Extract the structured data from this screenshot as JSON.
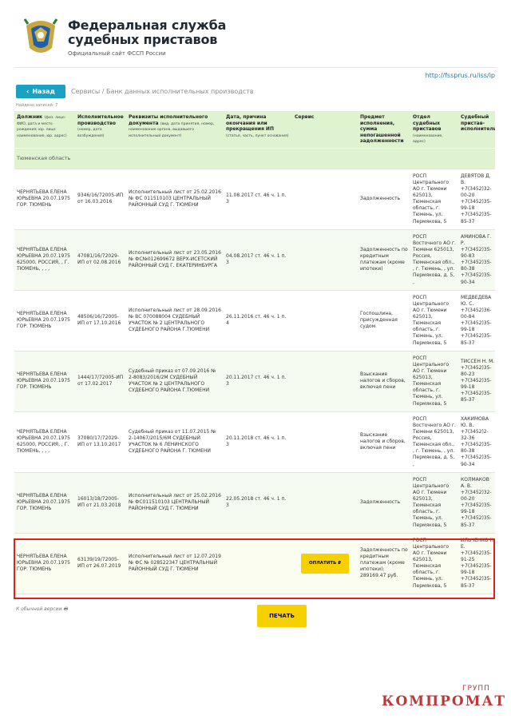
{
  "header": {
    "title_line1": "Федеральная служба",
    "title_line2": "судебных приставов",
    "subtitle": "Официальный сайт ФССП России"
  },
  "url": "http://fssprus.ru/iss/ip",
  "nav": {
    "back_label": "Назад",
    "breadcrumb": "Сервисы / Банк данных исполнительных производств"
  },
  "found": "Найдено записей: 7",
  "table": {
    "headers": [
      {
        "title": "Должник",
        "note": "(физ. лицо: ФИО, дата и место рождения; юр. лицо: наименование, юр. адрес)"
      },
      {
        "title": "Исполнительное производство",
        "note": "(номер, дата возбуждения)"
      },
      {
        "title": "Реквизиты исполнительного документа",
        "note": "(вид, дата принятия, номер, наименование органа, выдавшего исполнительный документ)"
      },
      {
        "title": "Дата, причина окончания или прекращения ИП",
        "note": "(статья, часть, пункт основания)"
      },
      {
        "title": "Сервис",
        "note": ""
      },
      {
        "title": "Предмет исполнения, сумма непогашенной задолженности",
        "note": ""
      },
      {
        "title": "Отдел судебных приставов",
        "note": "(наименование, адрес)"
      },
      {
        "title": "Судебный пристав-исполнитель",
        "note": ""
      }
    ],
    "region": "Тюменская область",
    "rows": [
      {
        "debtor": "ЧЕРНЯТЬЕВА ЕЛЕНА ЮРЬЕВНА 20.07.1975 ГОР. ТЮМЕНЬ",
        "ip": "9346/16/72005-ИП от 16.03.2016",
        "doc": "Исполнительный лист от 25.02.2016 № ФС 011510103 ЦЕНТРАЛЬНЫЙ РАЙОННЫЙ СУД Г. ТЮМЕНИ",
        "end": "11.08.2017 ст. 46 ч. 1 п. 3",
        "service": "",
        "subject": "Задолженность",
        "dept": "РОСП Центрального АО г. Тюмени 625013, Тюменская область, г. Тюмень, ул. Пермякова, 5",
        "bailiff": "ДЕВЯТОВ Д. В. +7(3452)32-00-20 +7(3452)35-99-18 +7(3452)35-85-37"
      },
      {
        "debtor": "ЧЕРНЯТЬЕВА ЕЛЕНА ЮРЬЕВНА 20.07.1975 625000, РОССИЯ, , Г. ТЮМЕНЬ, , , ,",
        "ip": "47081/16/72029-ИП от 02.08.2016",
        "doc": "Исполнительный лист от 23.05.2016 № ФС№012699672 ВЕРХ-ИСЕТСКИЙ РАЙОННЫЙ СУД Г. ЕКАТЕРИНБУРГА",
        "end": "04.08.2017 ст. 46 ч. 1 п. 3",
        "service": "",
        "subject": "Задолженность по кредитным платежам (кроме ипотеки)",
        "dept": "РОСП Восточного АО г. Тюмени 625013, Россия, Тюменская обл., , г. Тюмень, , ул. Пермякова, д. 5, ,",
        "bailiff": "АМИНОВА Г. Р. +7(3452)35-90-83 +7(3452)35-80-38 +7(3452)35-90-34"
      },
      {
        "debtor": "ЧЕРНЯТЬЕВА ЕЛЕНА ЮРЬЕВНА 20.07.1975 ГОР. ТЮМЕНЬ",
        "ip": "48506/16/72005-ИП от 17.10.2016",
        "doc": "Исполнительный лист от 28.09.2016 № ВС 070088004 СУДЕБНЫЙ УЧАСТОК № 2 ЦЕНТРАЛЬНОГО СУДЕБНОГО РАЙОНА Г.ТЮМЕНИ",
        "end": "26.11.2016 ст. 46 ч. 1 п. 4",
        "service": "",
        "subject": "Госпошлина, присужденная судом",
        "dept": "РОСП Центрального АО г. Тюмени 625013, Тюменская область, г. Тюмень, ул. Пермякова, 5",
        "bailiff": "МЕДВЕДЕВА Ю. С. +7(3452)36-00-84 +7(3452)35-99-18 +7(3452)35-85-37"
      },
      {
        "debtor": "ЧЕРНЯТЬЕВА ЕЛЕНА ЮРЬЕВНА 20.07.1975 ГОР. ТЮМЕНЬ",
        "ip": "1444/17/72005-ИП от 17.02.2017",
        "doc": "Судебный приказ от 07.09.2016 № 2-8083/2016/2М СУДЕБНЫЙ УЧАСТОК № 2 ЦЕНТРАЛЬНОГО СУДЕБНОГО РАЙОНА Г.ТЮМЕНИ",
        "end": "20.11.2017 ст. 46 ч. 1 п. 3",
        "service": "",
        "subject": "Взыскание налогов и сборов, включая пени",
        "dept": "РОСП Центрального АО г. Тюмени 625013, Тюменская область, г. Тюмень, ул. Пермякова, 5",
        "bailiff": "ТИССЕН Н. М. +7(3452)35-80-23 +7(3452)35-99-18 +7(3452)35-85-37"
      },
      {
        "debtor": "ЧЕРНЯТЬЕВА ЕЛЕНА ЮРЬЕВНА 20.07.1975 625000, РОССИЯ, , Г. ТЮМЕНЬ, , , ,",
        "ip": "37080/17/72029-ИП от 13.10.2017",
        "doc": "Судебный приказ от 11.07.2015 № 2-14067/2015/6М СУДЕБНЫЙ УЧАСТОК № 6 ЛЕНИНСКОГО СУДЕБНОГО РАЙОНА Г. ТЮМЕНИ",
        "end": "20.11.2018 ст. 46 ч. 1 п. 3",
        "service": "",
        "subject": "Взыскание налогов и сборов, включая пени",
        "dept": "РОСП Восточного АО г. Тюмени 625013, Россия, Тюменская обл., , г. Тюмень, , ул. Пермякова, д. 5, ,",
        "bailiff": "ХАКИМОВА Ю. В. +7(3452)2-32-36 +7(3452)35-80-38 +7(3452)35-90-34"
      },
      {
        "debtor": "ЧЕРНЯТЬЕВА ЕЛЕНА ЮРЬЕВНА 20.07.1975 ГОР. ТЮМЕНЬ",
        "ip": "16013/18/72005-ИП от 21.03.2018",
        "doc": "Исполнительный лист от 25.02.2016 № ФС011510103 ЦЕНТРАЛЬНЫЙ РАЙОННЫЙ СУД Г. ТЮМЕНИ",
        "end": "22.05.2018 ст. 46 ч. 1 п. 3",
        "service": "",
        "subject": "Задолженность",
        "dept": "РОСП Центрального АО г. Тюмени 625013, Тюменская область, г. Тюмень, ул. Пермякова, 5",
        "bailiff": "КОЛМАКОВ А. В. +7(3452)32-00-20 +7(3452)35-99-18 +7(3452)35-85-37"
      },
      {
        "debtor": "ЧЕРНЯТЬЕВА ЕЛЕНА ЮРЬЕВНА 20.07.1975 ГОР. ТЮМЕНЬ",
        "ip": "63139/19/72005-ИП от 26.07.2019",
        "doc": "Исполнительный лист от 12.07.2019 № ФС № 028522347 ЦЕНТРАЛЬНЫЙ РАЙОННЫЙ СУД Г. ТЮМЕНИ",
        "end": "",
        "service": "ОПЛАТИТЬ ₽",
        "subject": "Задолженность по кредитным платежам (кроме ипотеки): 289169.47 руб.",
        "dept": "РОСП Центрального АО г. Тюмени 625013, Тюменская область, г. Тюмень, ул. Пермякова, 5",
        "bailiff": "ИЛЬЧЕНКО Н. Е. +7(3452)35-91-25 +7(3452)35-99-18 +7(3452)35-85-37"
      }
    ]
  },
  "footer": {
    "old_version": "К обычной версии",
    "print_label": "ПЕЧАТЬ"
  },
  "watermark": {
    "main": "КОМПРОМАТ",
    "top": "ГРУПП"
  },
  "colors": {
    "accent": "#1ba1c2",
    "header_bg": "#dff3d1",
    "button_yellow": "#f7d000",
    "highlight_red": "#e0201f"
  }
}
